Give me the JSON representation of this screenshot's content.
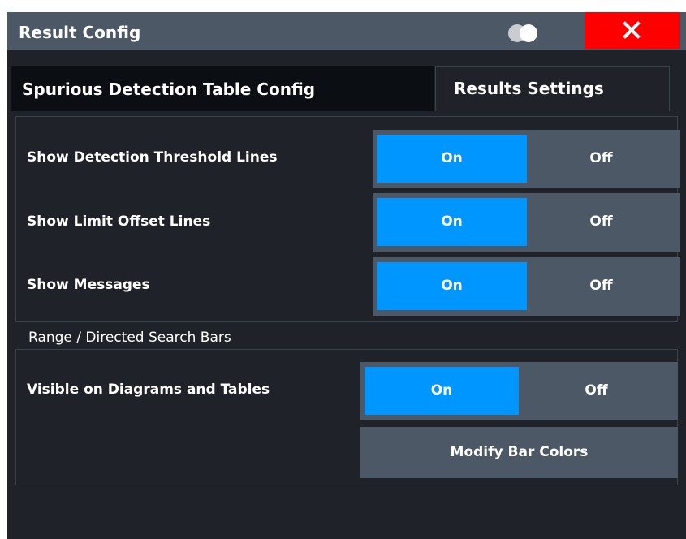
{
  "window": {
    "title": "Result Config"
  },
  "tabs": [
    {
      "label": "Spurious Detection Table Config",
      "active": false
    },
    {
      "label": "Results Settings",
      "active": true
    }
  ],
  "settings": {
    "rows": [
      {
        "label": "Show Detection Threshold Lines",
        "on_label": "On",
        "off_label": "Off",
        "value": "On"
      },
      {
        "label": "Show Limit Offset Lines",
        "on_label": "On",
        "off_label": "Off",
        "value": "On"
      },
      {
        "label": "Show Messages",
        "on_label": "On",
        "off_label": "Off",
        "value": "On"
      }
    ]
  },
  "search_bars": {
    "section_label": "Range / Directed Search Bars",
    "visible": {
      "label": "Visible on Diagrams and Tables",
      "on_label": "On",
      "off_label": "Off",
      "value": "On"
    },
    "modify_button": "Modify Bar Colors"
  },
  "colors": {
    "accent_on": "#0096ff",
    "close": "#ff0000",
    "panel": "#1f2329",
    "control": "#4d5866"
  },
  "icons": [
    "toggle-view-icon",
    "close-icon"
  ]
}
